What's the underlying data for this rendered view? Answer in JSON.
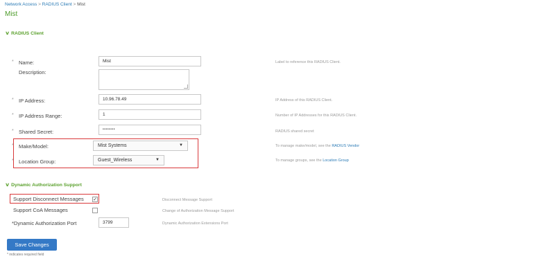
{
  "breadcrumb": {
    "items": [
      "Network Access",
      "RADIUS Client",
      "Mist"
    ],
    "separator": ">"
  },
  "page_title": "Mist",
  "radius_section": {
    "title": "RADIUS Client",
    "fields": {
      "name": {
        "label": "Name:",
        "value": "Mist",
        "help": "Label to reference this RADIUS Client.",
        "required": true
      },
      "description": {
        "label": "Description:",
        "value": "",
        "help": "",
        "required": false
      },
      "ip_address": {
        "label": "IP Address:",
        "value": "10.96.78.49",
        "help": "IP Address of this RADIUS Client.",
        "required": true
      },
      "ip_range": {
        "label": "IP Address Range:",
        "value": "1",
        "help": "Number of IP Addresses for this RADIUS Client.",
        "required": true
      },
      "shared_secret": {
        "label": "Shared Secret:",
        "value": "••••••••",
        "help": "RADIUS shared secret",
        "required": true
      },
      "make_model": {
        "label": "Make/Model:",
        "value": "Mist Systems",
        "help_text": "To manage make/model, see the",
        "help_link": "RADIUS Vendor",
        "required": true
      },
      "location_group": {
        "label": "Location Group:",
        "value": "Guest_Wireless",
        "help_text": "To manage groups, see the",
        "help_link": "Location Group",
        "required": true
      }
    }
  },
  "dynamic_section": {
    "title": "Dynamic Authorization Support",
    "fields": {
      "disconnect": {
        "label": "Support Disconnect Messages",
        "checked": true,
        "help": "Disconnect Message Support"
      },
      "coa": {
        "label": "Support CoA Messages",
        "checked": false,
        "help": "Change of Authorization Message Support"
      },
      "port": {
        "label": "*Dynamic Authorization Port",
        "value": "3799",
        "help": "Dynamic Authorization Extensions Port"
      }
    }
  },
  "save_button": "Save Changes",
  "footnote": "* indicates required field",
  "required_marker": "*",
  "colors": {
    "accent_green": "#5aa02c",
    "link_blue": "#2a7ab5",
    "button_blue": "#3479c6",
    "highlight_red": "#d9383a"
  },
  "icons": {
    "section_toggle": "chevron-down-icon",
    "select_arrow": "caret-down-icon",
    "checkbox_mark": "check-icon"
  }
}
